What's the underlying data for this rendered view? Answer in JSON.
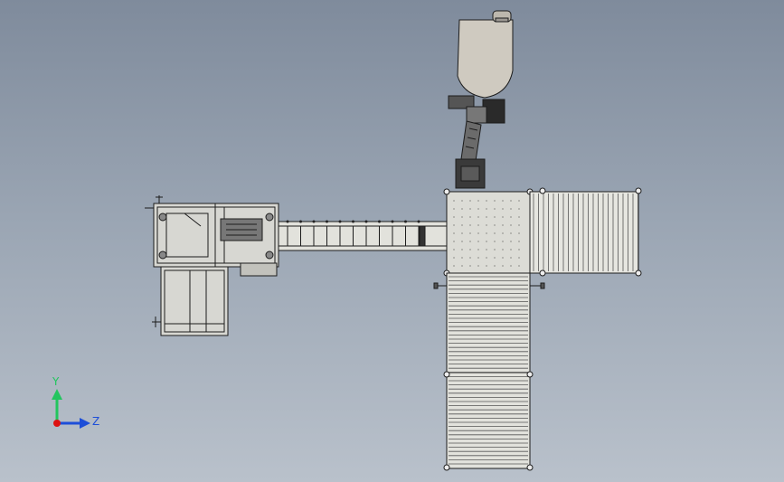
{
  "viewport": {
    "background_top": "#7f8b9c",
    "background_bottom": "#b9c1cb"
  },
  "triad": {
    "y_label": "Y",
    "z_label": "Z",
    "y_color": "#22c55e",
    "z_color": "#1d4ed8",
    "origin_color": "#d11"
  }
}
